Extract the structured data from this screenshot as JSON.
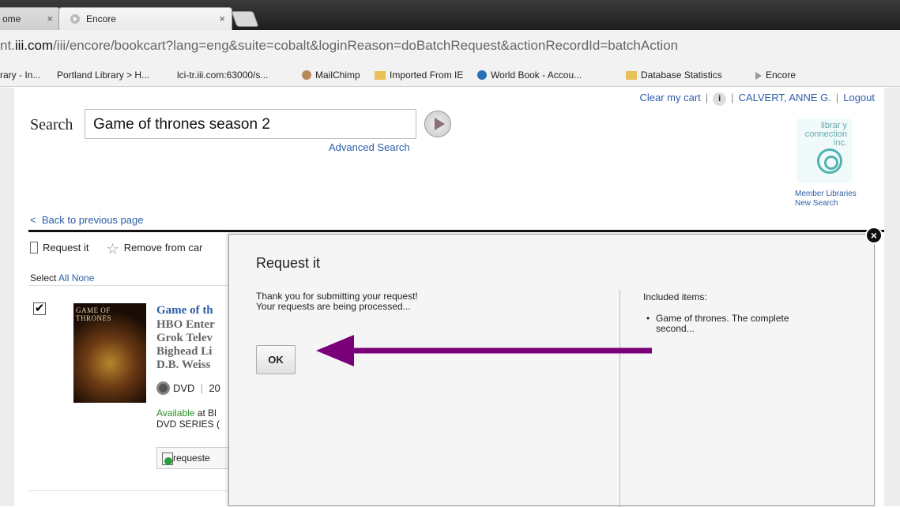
{
  "browser": {
    "tab1_label": "ome",
    "tab2_label": "Encore",
    "tab_close": "×",
    "url_dim_prefix": "nt.",
    "url_main": "iii.com",
    "url_rest": "/iii/encore/bookcart?lang=eng&suite=cobalt&loginReason=doBatchRequest&actionRecordId=batchAction",
    "bookmarks": [
      "rary - In...",
      "Portland Library > H...",
      "lci-tr.iii.com:63000/s...",
      "MailChimp",
      "Imported From IE",
      "World Book - Accou...",
      "Database Statistics",
      "Encore"
    ]
  },
  "header": {
    "clear_cart": "Clear my cart",
    "sep": "|",
    "info": "i",
    "user": "CALVERT, ANNE G.",
    "logout": "Logout"
  },
  "search": {
    "label": "Search",
    "value": "Game of thrones season 2",
    "advanced": "Advanced Search"
  },
  "logo": {
    "line1": "librar y",
    "line2": "connection",
    "line3": "inc.",
    "member_libraries": "Member Libraries",
    "new_search": "New Search"
  },
  "nav": {
    "back": "Back to previous page",
    "back_chevron": "<"
  },
  "cart": {
    "request_it": "Request it",
    "remove": "Remove from car",
    "select_label": "Select",
    "select_all": "All",
    "select_none": "None",
    "checkmark": "✔",
    "item": {
      "cover_title": "GAME OF THRONES",
      "title": "Game of th",
      "meta": "HBO Enter\nGrok Telev\nBighead Li\nD.B. Weiss",
      "format": "DVD",
      "format_sep": "|",
      "year": "20",
      "available": "Available",
      "at": " at Bl",
      "shelf": "DVD SERIES (",
      "requested": "requeste"
    }
  },
  "modal": {
    "title": "Request it",
    "message_line1": "Thank you for submitting your request!",
    "message_line2": "Your requests are being processed...",
    "ok": "OK",
    "included_label": "Included items:",
    "included_items": [
      "Game of thrones. The complete second..."
    ],
    "close": "×"
  },
  "colors": {
    "link": "#2b5ea8",
    "arrow": "#7a007a",
    "available": "#2a8f2a"
  }
}
